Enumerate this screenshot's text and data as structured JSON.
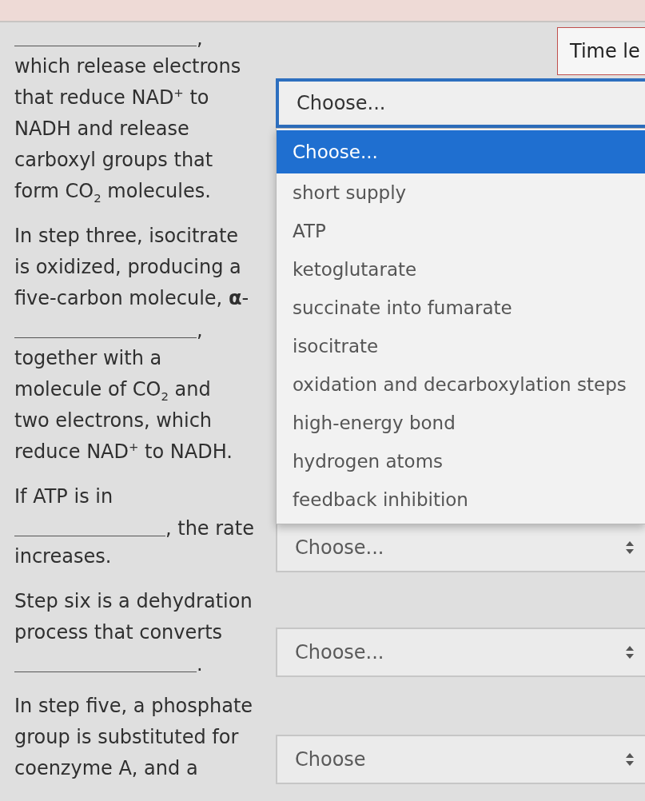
{
  "timer": {
    "label": "Time le"
  },
  "questions": [
    {
      "parts": [
        {
          "kind": "blank",
          "tail": ","
        },
        {
          "kind": "text",
          "text": "which release electrons\nthat reduce NAD$^{+}$ to\nNADH and release\ncarboxyl groups that\nform CO$_{2}$ molecules."
        }
      ],
      "select": {
        "value": "Choose...",
        "expanded": true,
        "options": [
          {
            "label": "Choose...",
            "selected": true
          },
          {
            "label": "short supply",
            "selected": false
          },
          {
            "label": "ATP",
            "selected": false
          },
          {
            "label": "ketoglutarate",
            "selected": false
          },
          {
            "label": "succinate into fumarate",
            "selected": false
          },
          {
            "label": "isocitrate",
            "selected": false
          },
          {
            "label": "oxidation and decarboxylation steps",
            "selected": false
          },
          {
            "label": "high-energy bond",
            "selected": false
          },
          {
            "label": "hydrogen atoms",
            "selected": false
          },
          {
            "label": "feedback inhibition",
            "selected": false
          }
        ]
      }
    },
    {
      "parts": [
        {
          "kind": "text",
          "text": "In step three, isocitrate\nis oxidized, producing a\nfive-carbon molecule, **α**-"
        },
        {
          "kind": "blank",
          "tail": ","
        },
        {
          "kind": "text",
          "text": "together with a\nmolecule of CO$_{2}$ and\ntwo electrons, which\nreduce NAD$^{+}$ to NADH."
        }
      ]
    },
    {
      "parts": [
        {
          "kind": "text",
          "text": "If ATP is in"
        },
        {
          "kind": "blank",
          "tail": ", the rate"
        },
        {
          "kind": "text",
          "text": "increases."
        }
      ],
      "select": {
        "value": "Choose...",
        "expanded": false
      }
    },
    {
      "parts": [
        {
          "kind": "text",
          "text": "Step six is a dehydration\nprocess that converts"
        },
        {
          "kind": "blank",
          "tail": "."
        }
      ],
      "select": {
        "value": "Choose...",
        "expanded": false
      }
    },
    {
      "parts": [
        {
          "kind": "text",
          "text": "In step five, a phosphate\ngroup is substituted for\ncoenzyme A, and a"
        }
      ],
      "select": {
        "value": "Choose",
        "expanded": false
      }
    }
  ]
}
